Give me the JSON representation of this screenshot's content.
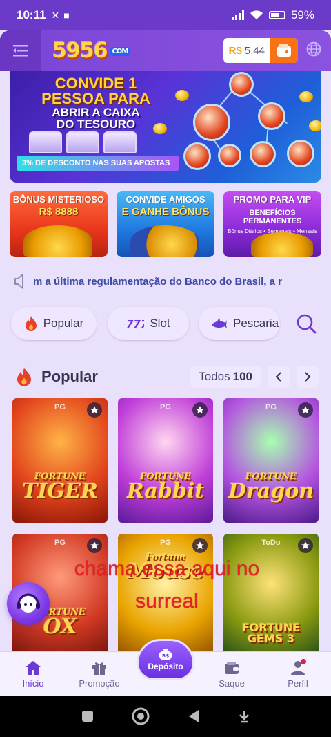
{
  "status_bar": {
    "time": "10:11",
    "battery": "59%"
  },
  "header": {
    "logo": "5956",
    "logo_suffix": "COM",
    "currency": "R$",
    "balance": "5,44"
  },
  "banner": {
    "line1": "CONVIDE 1",
    "line2": "PESSOA PARA",
    "line3": "ABRIR A CAIXA",
    "line4": "DO TESOURO",
    "discount": "3% DE DESCONTO NAS SUAS APOSTAS"
  },
  "promos": [
    {
      "title": "BÔNUS MISTERIOSO",
      "sub": "R$ 8888"
    },
    {
      "title": "CONVIDE AMIGOS",
      "sub": "E GANHE BÔNUS"
    },
    {
      "title": "PROMO PARA VIP",
      "sub": "BENEFÍCIOS PERMANENTES",
      "note": "Bônus Diários • Semanais • Mensais"
    }
  ],
  "marquee": {
    "text": "m a última regulamentação do Banco do Brasil, a r"
  },
  "tabs": [
    {
      "label": "Popular"
    },
    {
      "label": "Slot"
    },
    {
      "label": "Pescaria"
    }
  ],
  "section": {
    "title": "Popular",
    "all_label": "Todos",
    "all_count": "100"
  },
  "games": [
    {
      "provider": "PG",
      "first": "FORTUNE",
      "main": "TIGER"
    },
    {
      "provider": "PG",
      "first": "FORTUNE",
      "main": "Rabbit"
    },
    {
      "provider": "PG",
      "first": "FORTUNE",
      "main": "Dragon"
    },
    {
      "provider": "PG",
      "first": "FORTUNE",
      "main": "OX"
    },
    {
      "provider": "PG",
      "first": "Fortune",
      "main": "Mouse"
    },
    {
      "provider": "ToDo",
      "first": "",
      "main": "FORTUNE GEMS 3"
    }
  ],
  "overlay_caption": {
    "line1": "chama essa aqui no",
    "line2": "surreal"
  },
  "bottom_nav": {
    "inicio": "Início",
    "promocao": "Promoção",
    "deposito": "Depósito",
    "saque": "Saque",
    "perfil": "Perfil"
  },
  "colors": {
    "accent": "#7a45d6",
    "wallet": "#f97316",
    "caption": "#e8212a"
  }
}
